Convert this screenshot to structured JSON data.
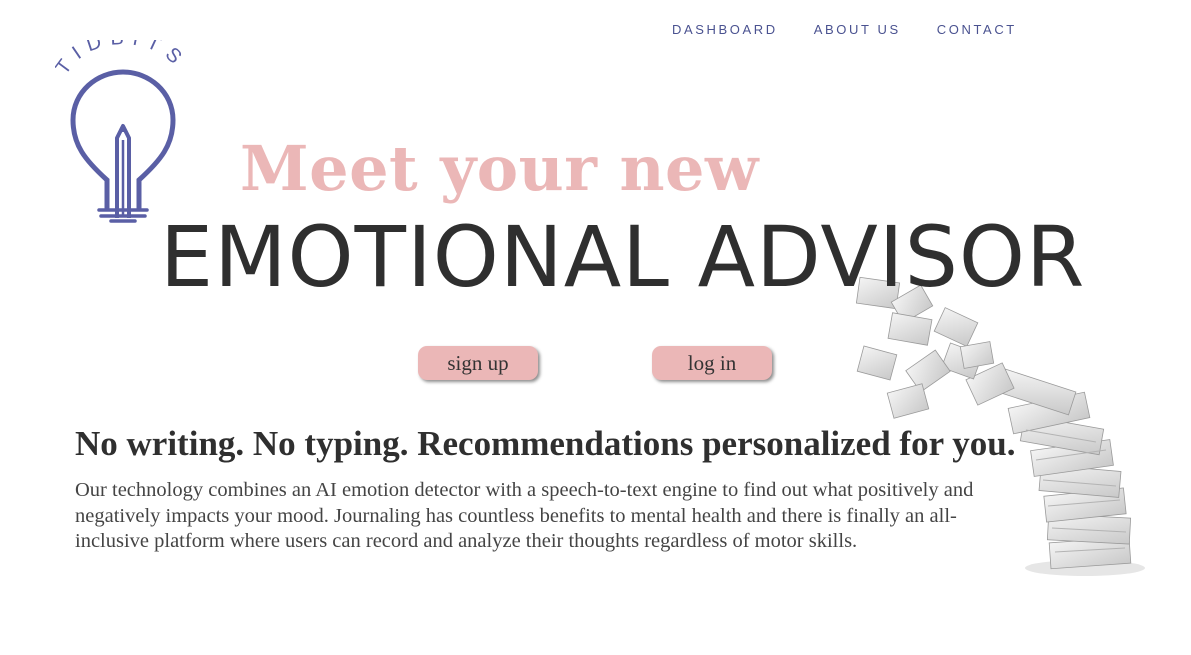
{
  "nav": {
    "items": [
      {
        "label": "DASHBOARD"
      },
      {
        "label": "ABOUT US"
      },
      {
        "label": "CONTACT"
      }
    ]
  },
  "brand": {
    "logo_text": "TIDBITS",
    "icon": "lightbulb-pencil-icon",
    "color": "#5a5fa5"
  },
  "hero": {
    "tagline": "Meet your new",
    "headline": "EMOTIONAL ADVISOR",
    "accent_color": "#ebb7b7"
  },
  "buttons": {
    "signup_label": "sign up",
    "login_label": "log in"
  },
  "content": {
    "subheading": "No writing. No typing. Recommendations personalized for you.",
    "description": "Our technology combines an AI emotion detector with a speech-to-text engine to find out what positively and negatively impacts your mood. Journaling has countless benefits to mental health and there is finally an all-inclusive platform where users can record and analyze their thoughts regardless of motor skills."
  },
  "decor": {
    "illustration": "flying-papers-stack-icon"
  }
}
